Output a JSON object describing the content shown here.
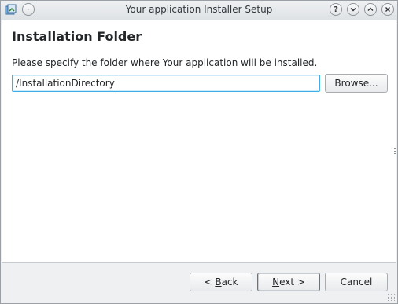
{
  "window": {
    "title": "Your application Installer Setup"
  },
  "titlebar_buttons": {
    "help_icon": "help-icon",
    "minimize_icon": "chevron-down-icon",
    "maximize_icon": "chevron-up-icon",
    "close_icon": "close-icon"
  },
  "page": {
    "heading": "Installation Folder",
    "description": "Please specify the folder where Your application will be installed.",
    "path_value": "/InstallationDirectory",
    "browse_label": "Browse..."
  },
  "footer": {
    "back_accel": "B",
    "back_rest": "ack",
    "next_accel": "N",
    "next_rest": "ext >",
    "cancel_label": "Cancel"
  },
  "colors": {
    "focus_border": "#3daee9",
    "window_bg": "#eff0f1"
  }
}
